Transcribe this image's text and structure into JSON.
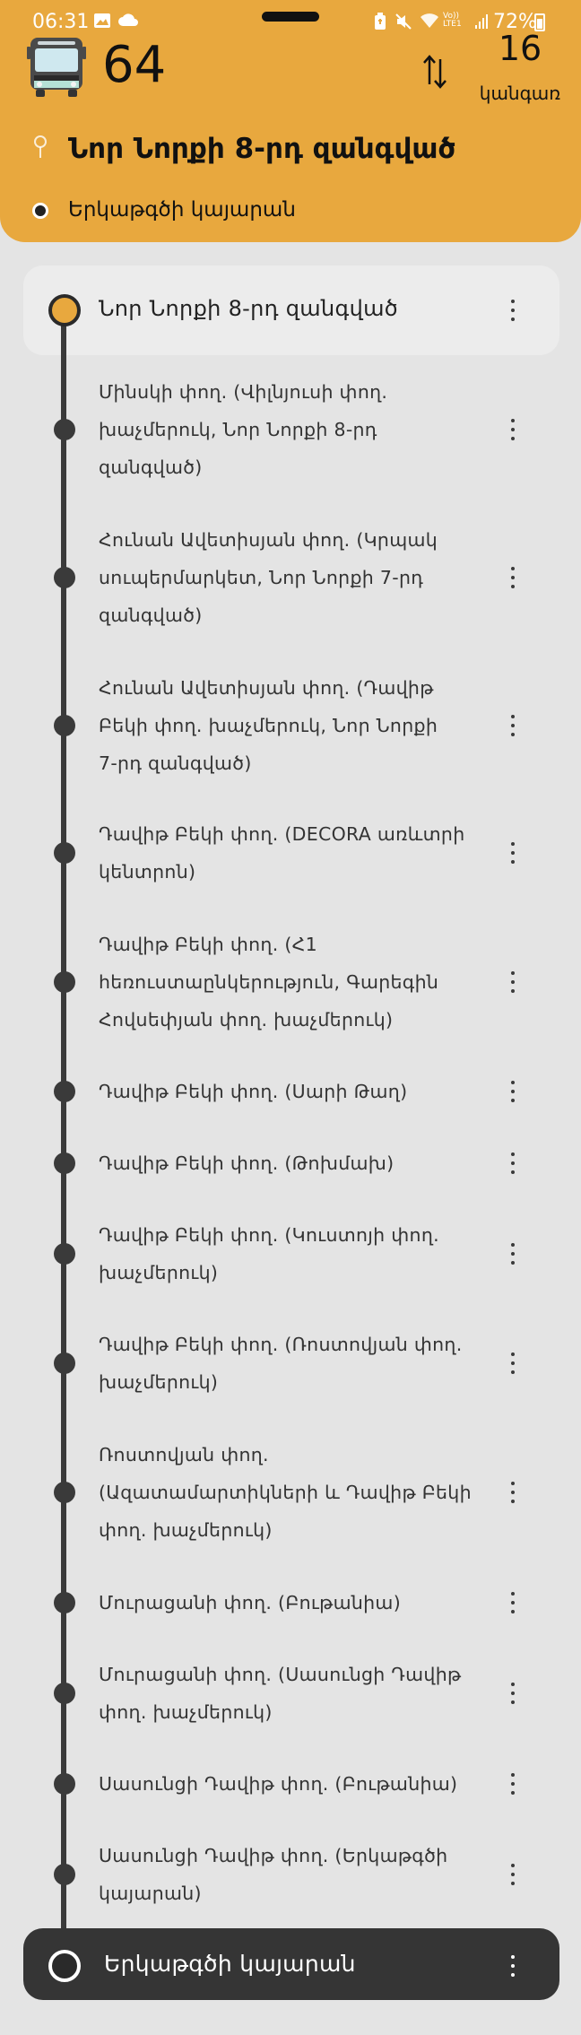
{
  "status_bar": {
    "time": "06:31",
    "battery": "72%",
    "network": "LTE1"
  },
  "route": {
    "number": "64",
    "stops_count": "16",
    "stops_label": "կանգառ",
    "from": "Նոր Նորքի 8-րդ զանգված",
    "to": "Երկաթգծի կայարան"
  },
  "colors": {
    "accent": "#e8a83e",
    "line": "#3a3a3a",
    "background": "#e4e4e4"
  },
  "stops": [
    {
      "name": "Նոր Նորքի 8-րդ զանգված"
    },
    {
      "lines": [
        "Մինսկի փող. (Վիլնյուսի փող.",
        "խաչմերուկ, Նոր Նորքի 8-րդ",
        "զանգված)"
      ]
    },
    {
      "lines": [
        "Հունան Ավետիսյան փող. (Կրպակ",
        "սուպերմարկետ, Նոր Նորքի 7-րդ",
        "զանգված)"
      ]
    },
    {
      "lines": [
        "Հունան Ավետիսյան փող. (Դավիթ",
        "Բեկի փող. խաչմերուկ, Նոր Նորքի",
        "7-րդ զանգված)"
      ]
    },
    {
      "lines": [
        "Դավիթ Բեկի փող. (DECORA առևտրի",
        "կենտրոն)"
      ]
    },
    {
      "lines": [
        "Դավիթ Բեկի փող. (Հ1",
        "հեռուստաընկերություն, Գարեգին",
        "Հովսեփյան փող. խաչմերուկ)"
      ]
    },
    {
      "lines": [
        "Դավիթ Բեկի փող. (Սարի Թաղ)"
      ]
    },
    {
      "lines": [
        "Դավիթ Բեկի փող. (Թոխմախ)"
      ]
    },
    {
      "lines": [
        "Դավիթ Բեկի փող. (Կուստոյի փող.",
        "խաչմերուկ)"
      ]
    },
    {
      "lines": [
        "Դավիթ Բեկի փող. (Ռոստովյան փող.",
        "խաչմերուկ)"
      ]
    },
    {
      "lines": [
        "Ռոստովյան փող.",
        "(Ազատամարտիկների և Դավիթ Բեկի",
        "փող. խաչմերուկ)"
      ]
    },
    {
      "lines": [
        "Մուրացանի փող. (Բութանիա)"
      ]
    },
    {
      "lines": [
        "Մուրացանի փող. (Սասունցի Դավիթ",
        "փող. խաչմերուկ)"
      ]
    },
    {
      "lines": [
        "Սասունցի Դավիթ փող. (Բութանիա)"
      ]
    },
    {
      "lines": [
        "Սասունցի Դավիթ փող. (Երկաթգծի",
        "կայարան)"
      ]
    },
    {
      "name": "Երկաթգծի կայարան"
    }
  ]
}
